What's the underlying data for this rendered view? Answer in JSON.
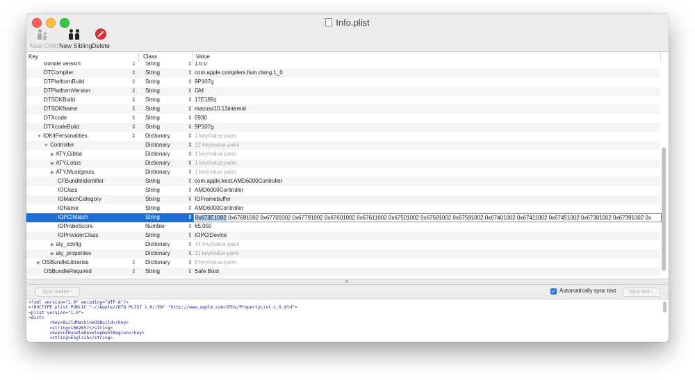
{
  "window": {
    "title": "Info.plist"
  },
  "toolbar": {
    "new_child": "New Child",
    "new_sibling": "New Sibling",
    "delete": "Delete"
  },
  "columns": {
    "key": "Key",
    "class": "Class",
    "value": "Value"
  },
  "rows": [
    {
      "key": "Bundle version",
      "cls": "String",
      "value": "1.6.0",
      "indent": 0,
      "tri": "",
      "stepper": true,
      "dim": false,
      "partial": true
    },
    {
      "key": "DTCompiler",
      "cls": "String",
      "value": "com.apple.compilers.llvm.clang.1_0",
      "indent": 0,
      "tri": "",
      "stepper": true,
      "dim": false
    },
    {
      "key": "DTPlatformBuild",
      "cls": "String",
      "value": "9P107g",
      "indent": 0,
      "tri": "",
      "stepper": true,
      "dim": false
    },
    {
      "key": "DTPlatformVersion",
      "cls": "String",
      "value": "GM",
      "indent": 0,
      "tri": "",
      "stepper": true,
      "dim": false
    },
    {
      "key": "DTSDKBuild",
      "cls": "String",
      "value": "17E189z",
      "indent": 0,
      "tri": "",
      "stepper": true,
      "dim": false
    },
    {
      "key": "DTSDKName",
      "cls": "String",
      "value": "macosx10.13internal",
      "indent": 0,
      "tri": "",
      "stepper": true,
      "dim": false
    },
    {
      "key": "DTXcode",
      "cls": "String",
      "value": "0930",
      "indent": 0,
      "tri": "",
      "stepper": true,
      "dim": false
    },
    {
      "key": "DTXcodeBuild",
      "cls": "String",
      "value": "9P107g",
      "indent": 0,
      "tri": "",
      "stepper": true,
      "dim": false
    },
    {
      "key": "IOKitPersonalities",
      "cls": "Dictionary",
      "value": "1 key/value pairs",
      "indent": 0,
      "tri": "▼",
      "stepper": true,
      "dim": true
    },
    {
      "key": "Controller",
      "cls": "Dictionary",
      "value": "12 key/value pairs",
      "indent": 1,
      "tri": "▼",
      "stepper": false,
      "dim": true
    },
    {
      "key": "ATY,Gibba",
      "cls": "Dictionary",
      "value": "1 key/value pairs",
      "indent": 2,
      "tri": "▶",
      "stepper": false,
      "dim": true
    },
    {
      "key": "ATY,Lotus",
      "cls": "Dictionary",
      "value": "1 key/value pairs",
      "indent": 2,
      "tri": "▶",
      "stepper": false,
      "dim": true
    },
    {
      "key": "ATY,Muskgrass",
      "cls": "Dictionary",
      "value": "1 key/value pairs",
      "indent": 2,
      "tri": "▶",
      "stepper": false,
      "dim": true
    },
    {
      "key": "CFBundleIdentifier",
      "cls": "String",
      "value": "com.apple.kext.AMD6000Controller",
      "indent": 2,
      "tri": "",
      "stepper": false,
      "dim": false
    },
    {
      "key": "IOClass",
      "cls": "String",
      "value": "AMD6000Controller",
      "indent": 2,
      "tri": "",
      "stepper": false,
      "dim": false
    },
    {
      "key": "IOMatchCategory",
      "cls": "String",
      "value": "IOFramebuffer",
      "indent": 2,
      "tri": "",
      "stepper": false,
      "dim": false
    },
    {
      "key": "IOName",
      "cls": "String",
      "value": "AMD6000Controller",
      "indent": 2,
      "tri": "",
      "stepper": false,
      "dim": false
    },
    {
      "key": "IOPCIMatch",
      "cls": "String",
      "value": "",
      "indent": 2,
      "tri": "",
      "stepper": false,
      "dim": false,
      "selected": true
    },
    {
      "key": "IOProbeScore",
      "cls": "Number",
      "value": "65,050",
      "indent": 2,
      "tri": "",
      "stepper": false,
      "dim": false
    },
    {
      "key": "IOProviderClass",
      "cls": "String",
      "value": "IOPCIDevice",
      "indent": 2,
      "tri": "",
      "stepper": false,
      "dim": false
    },
    {
      "key": "aty_config",
      "cls": "Dictionary",
      "value": "14 key/value pairs",
      "indent": 2,
      "tri": "▶",
      "stepper": false,
      "dim": true
    },
    {
      "key": "aty_properties",
      "cls": "Dictionary",
      "value": "11 key/value pairs",
      "indent": 2,
      "tri": "▶",
      "stepper": false,
      "dim": true
    },
    {
      "key": "OSBundleLibraries",
      "cls": "Dictionary",
      "value": "8 key/value pairs",
      "indent": 0,
      "tri": "▶",
      "stepper": true,
      "dim": true
    },
    {
      "key": "OSBundleRequired",
      "cls": "String",
      "value": "Safe Boot",
      "indent": 0,
      "tri": "",
      "stepper": true,
      "dim": false
    }
  ],
  "editing": {
    "selected_part": "0x673E1002",
    "rest": " 0x67681002 0x67701002 0x67791002 0x67601002 0x67611002 0x67501002 0x67581002 0x67591002 0x67401002 0x67411002 0x67451002 0x67381002 0x67391002 0x"
  },
  "sync": {
    "sync_outline": "Sync outline ↑",
    "auto_sync_label": "Automatically sync text",
    "auto_sync_checked": true,
    "sync_text": "Sync text ↓"
  },
  "source_lines": [
    "<?xml version=\"1.0\" encoding=\"UTF-8\"?>",
    "<!DOCTYPE plist PUBLIC \"-//Apple//DTD PLIST 1.0//EN\" \"http://www.apple.com/DTDs/PropertyList-1.0.dtd\">",
    "<plist version=\"1.0\">",
    "<dict>",
    "        <key>BuildMachineOSBuild</key>",
    "        <string>16B2657</string>",
    "        <key>CFBundleDevelopmentRegion</key>",
    "        <string>English</string>"
  ]
}
